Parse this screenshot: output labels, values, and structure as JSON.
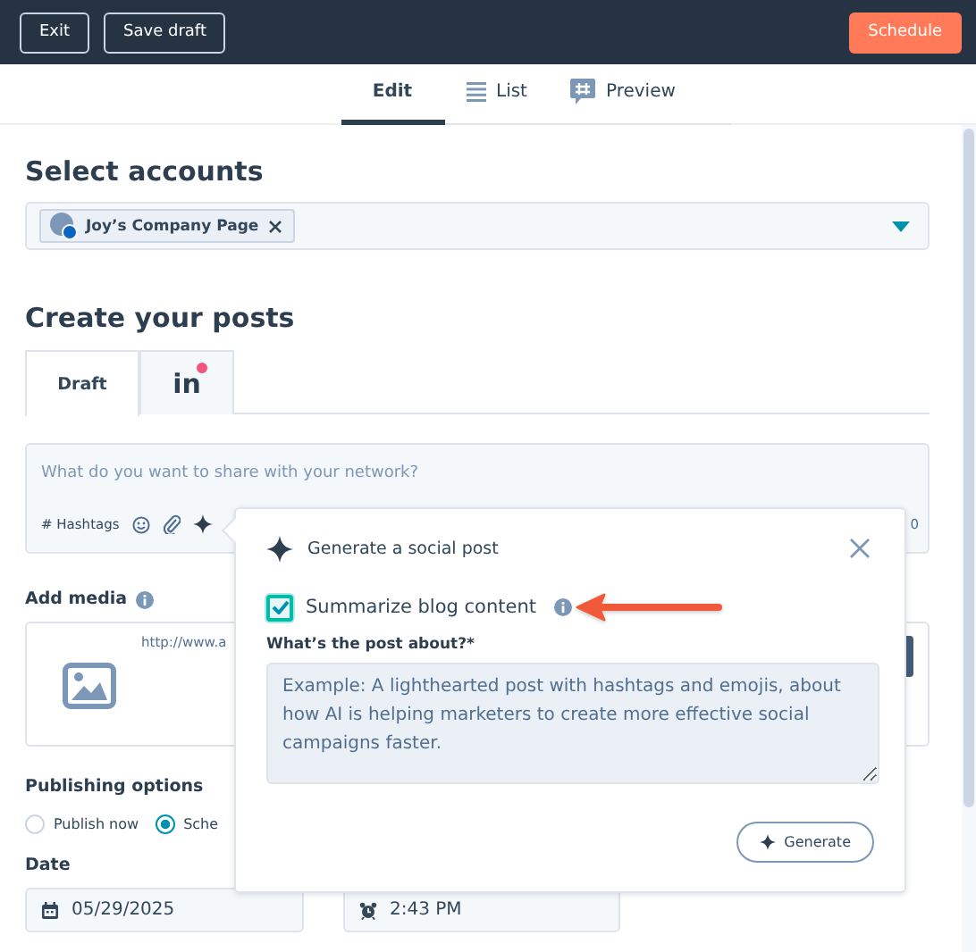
{
  "topbar": {
    "buttons": [
      {
        "label": "Exit"
      },
      {
        "label": "Save draft"
      }
    ],
    "primary_button": "Schedule"
  },
  "view_tabs": [
    {
      "label": "Edit",
      "selected": true
    },
    {
      "label": "List",
      "selected": false
    },
    {
      "label": "Preview",
      "selected": false
    }
  ],
  "accounts": {
    "heading": "Select accounts",
    "chips": [
      {
        "label": "Joy’s Company Page"
      }
    ]
  },
  "posts": {
    "heading": "Create your posts",
    "tabs": [
      {
        "kind": "text",
        "label": "Draft",
        "selected": true,
        "alert": false
      },
      {
        "kind": "network",
        "label": "in",
        "selected": false,
        "alert": true
      }
    ]
  },
  "composer": {
    "placeholder": "What do you want to share with your network?",
    "hashtags": "# Hashtags",
    "char_count": "0"
  },
  "media": {
    "label": "Add media",
    "url": "http://www.a"
  },
  "publishing": {
    "label": "Publishing options",
    "options": [
      {
        "label": "Publish now",
        "selected": false
      },
      {
        "label": "Sche",
        "selected": true
      }
    ]
  },
  "date": {
    "label": "Date",
    "value": "05/29/2025"
  },
  "time": {
    "value": "2:43 PM"
  },
  "popover": {
    "title": "Generate a social post",
    "checkbox": {
      "label": "Summarize blog content",
      "checked": true
    },
    "prompt_label": "What’s the post about?*",
    "placeholder": "Example: A lighthearted post with hashtags and emojis, about how AI is helping marketers to create more effective social campaigns faster.",
    "button": "Generate"
  }
}
